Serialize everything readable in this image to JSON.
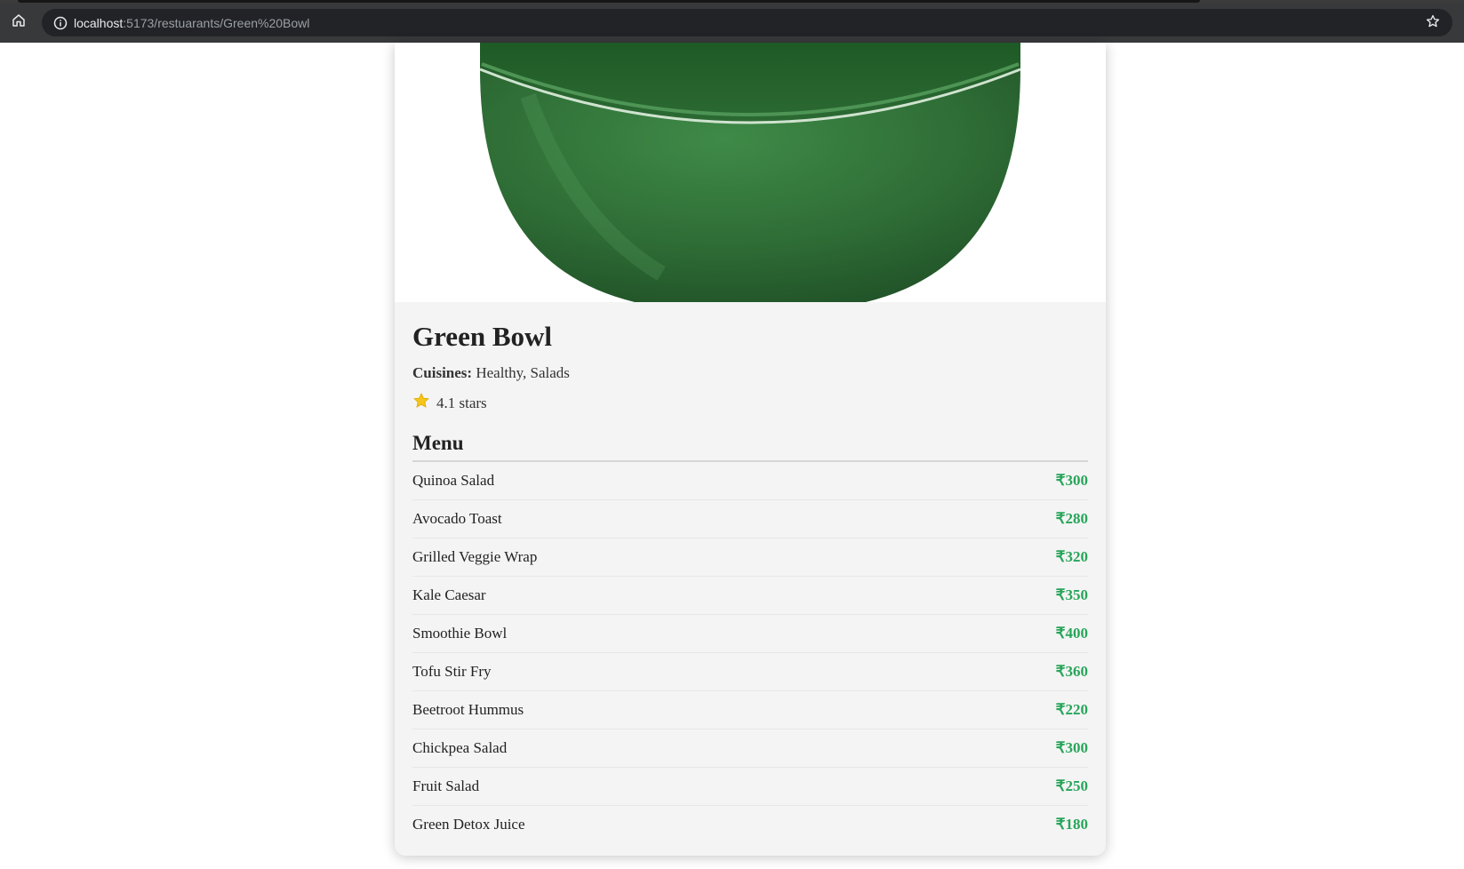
{
  "browser": {
    "url_host": "localhost",
    "url_path": ":5173/restuarants/Green%20Bowl"
  },
  "restaurant": {
    "name": "Green Bowl",
    "cuisines_label": "Cuisines:",
    "cuisines": "Healthy, Salads",
    "rating_text": "4.1 stars",
    "rating_value": 4.1
  },
  "menu": {
    "heading": "Menu",
    "items": [
      {
        "name": "Quinoa Salad",
        "price": "₹300"
      },
      {
        "name": "Avocado Toast",
        "price": "₹280"
      },
      {
        "name": "Grilled Veggie Wrap",
        "price": "₹320"
      },
      {
        "name": "Kale Caesar",
        "price": "₹350"
      },
      {
        "name": "Smoothie Bowl",
        "price": "₹400"
      },
      {
        "name": "Tofu Stir Fry",
        "price": "₹360"
      },
      {
        "name": "Beetroot Hummus",
        "price": "₹220"
      },
      {
        "name": "Chickpea Salad",
        "price": "₹300"
      },
      {
        "name": "Fruit Salad",
        "price": "₹250"
      },
      {
        "name": "Green Detox Juice",
        "price": "₹180"
      }
    ]
  },
  "icons": {
    "home": "home-icon",
    "info": "info-icon",
    "bookmark": "star-outline-icon",
    "rating": "star-icon"
  },
  "colors": {
    "price": "#27a55a",
    "bowl": "#2f6e36",
    "star": "#f5c518"
  }
}
